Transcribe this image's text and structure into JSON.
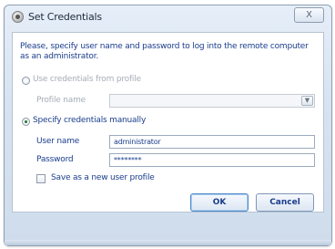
{
  "dialog": {
    "title": "Set Credentials",
    "close_label": "X",
    "instruction": "Please, specify user name and password to log into the remote computer as an administrator.",
    "use_profile_label": "Use credentials from profile",
    "profile_name_label": "Profile name",
    "profile_name_value": "",
    "specify_manual_label": "Specify credentials manually",
    "user_name_label": "User name",
    "user_name_value": "administrator",
    "password_label": "Password",
    "password_value": "********",
    "save_profile_label": "Save as a new user profile",
    "ok_label": "OK",
    "cancel_label": "Cancel",
    "selected_option": "specify-manually",
    "save_profile_checked": false
  }
}
